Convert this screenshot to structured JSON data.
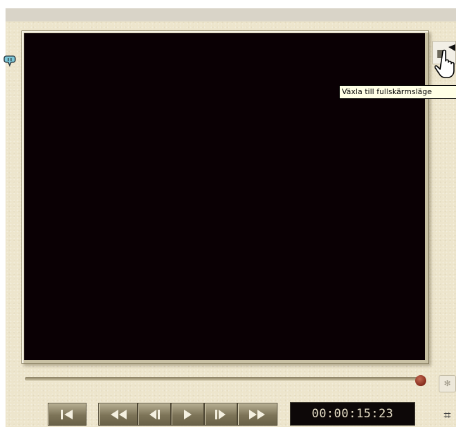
{
  "tooltip": {
    "text": "Växla till fullskärmsläge"
  },
  "timecode": {
    "value": "00:00:15:23"
  },
  "scrubber": {
    "position_fraction": 1.0
  },
  "icons": {
    "marker": "marker-icon",
    "fullscreen": "fullscreen-icon",
    "cursor": "hand-cursor-icon",
    "go_to_start": "skip-to-start-icon",
    "rewind": "rewind-icon",
    "step_back": "step-back-icon",
    "play": "play-icon",
    "step_forward": "step-forward-icon",
    "fast_forward": "fast-forward-icon",
    "side_top": "settings-icon",
    "side_bottom": "split-icon"
  },
  "colors": {
    "panel_bg": "#ede5cc",
    "preview_bg": "#0a0004",
    "button_fg": "#f4f0e0",
    "handle": "#8a3020"
  }
}
